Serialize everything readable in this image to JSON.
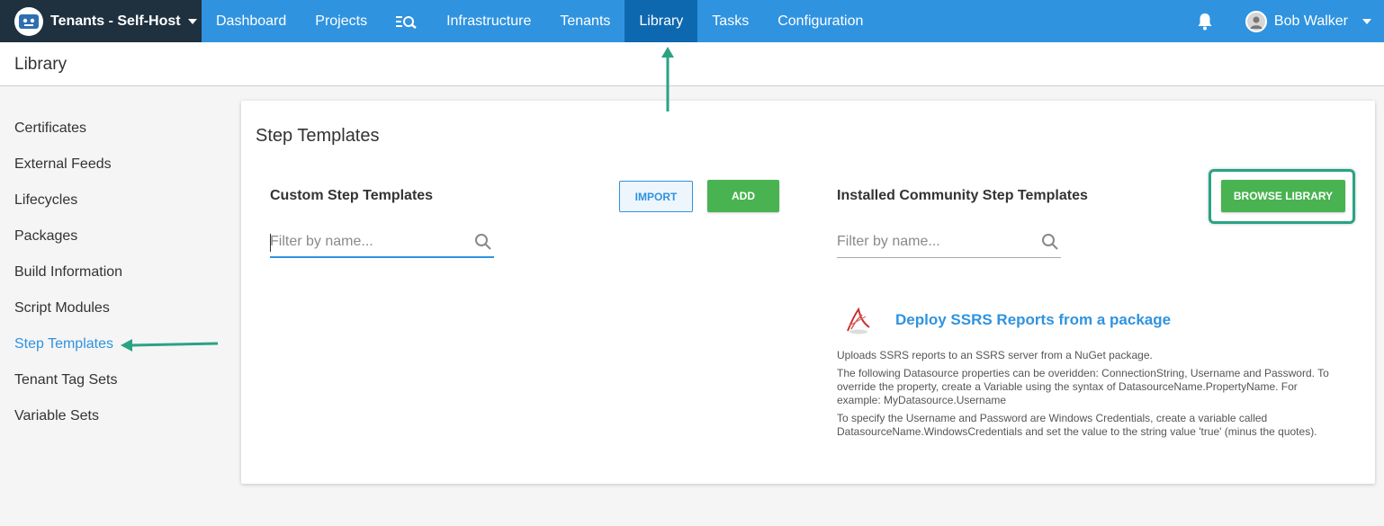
{
  "nav": {
    "space_name": "Tenants - Self-Host",
    "items": [
      "Dashboard",
      "Projects",
      "Infrastructure",
      "Tenants",
      "Library",
      "Tasks",
      "Configuration"
    ],
    "active": "Library",
    "user_name": "Bob Walker",
    "icons": [
      "octopus-logo-icon",
      "search-tasks-icon",
      "bell-icon",
      "avatar"
    ]
  },
  "page": {
    "title": "Library"
  },
  "sidebar": {
    "items": [
      {
        "label": "Certificates"
      },
      {
        "label": "External Feeds"
      },
      {
        "label": "Lifecycles"
      },
      {
        "label": "Packages"
      },
      {
        "label": "Build Information"
      },
      {
        "label": "Script Modules"
      },
      {
        "label": "Step Templates"
      },
      {
        "label": "Tenant Tag Sets"
      },
      {
        "label": "Variable Sets"
      }
    ],
    "active": "Step Templates"
  },
  "main": {
    "title": "Step Templates",
    "custom": {
      "title": "Custom Step Templates",
      "import_label": "IMPORT",
      "add_label": "ADD",
      "filter_placeholder": "Filter by name..."
    },
    "community": {
      "title": "Installed Community Step Templates",
      "browse_label": "BROWSE LIBRARY",
      "filter_placeholder": "Filter by name...",
      "templates": [
        {
          "name": "Deploy SSRS Reports from a package",
          "icon": "ssrs-icon",
          "description": [
            "Uploads SSRS reports to an SSRS server from a NuGet package.",
            "The following Datasource properties can be overidden: ConnectionString, Username and Password. To override the property, create a Variable using the syntax of DatasourceName.PropertyName. For example: MyDatasource.Username",
            "To specify the Username and Password are Windows Credentials, create a variable called DatasourceName.WindowsCredentials and set the value to the string value 'true' (minus the quotes)."
          ]
        }
      ]
    }
  },
  "colors": {
    "nav_blue": "#2f93e0",
    "nav_active": "#0e68b0",
    "space_bg": "#1f303f",
    "green": "#48b350",
    "annotation": "#2aa383"
  }
}
